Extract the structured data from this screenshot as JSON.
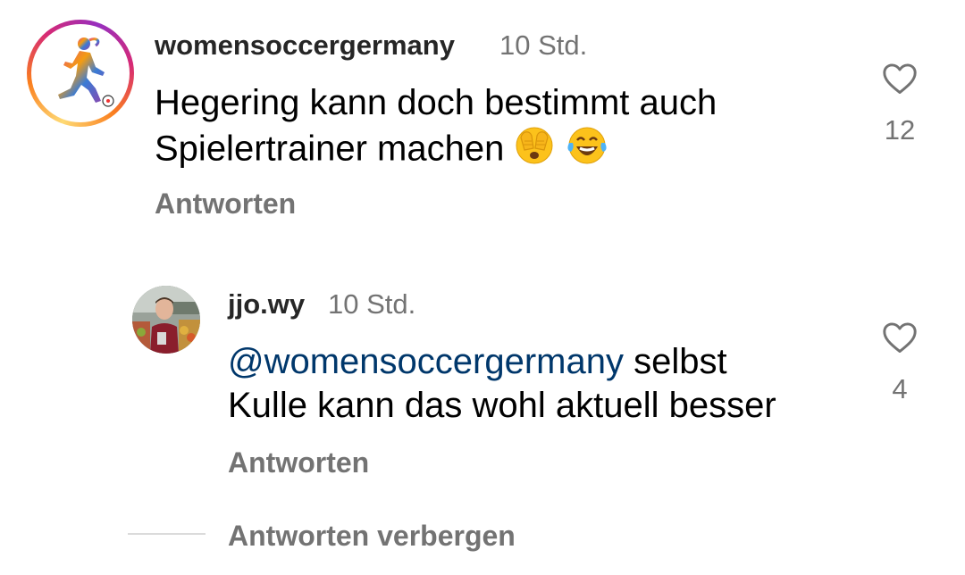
{
  "comment": {
    "username": "womensoccergermany",
    "time": "10 Std.",
    "text_line1": "Hegering kann doch bestimmt auch",
    "text_line2": "Spielertrainer machen",
    "emojis": [
      "face-with-hand-over-eyes-emoji",
      "tears-of-joy-emoji"
    ],
    "reply_label": "Antworten",
    "like_icon": "heart-outline-icon",
    "like_count": "12"
  },
  "reply": {
    "username": "jjo.wy",
    "time": "10 Std.",
    "mention": "@womensoccergermany",
    "text_line1_rest": " selbst",
    "text_line2": "Kulle kann das wohl aktuell besser",
    "reply_label": "Antworten",
    "like_icon": "heart-outline-icon",
    "like_count": "4"
  },
  "hide_replies_label": "Antworten verbergen",
  "colors": {
    "username": "#262626",
    "secondary": "#737373",
    "mention": "#00376b",
    "ring_gradient": [
      "#feda75",
      "#fa7e1e",
      "#d62976",
      "#962fbf"
    ]
  }
}
